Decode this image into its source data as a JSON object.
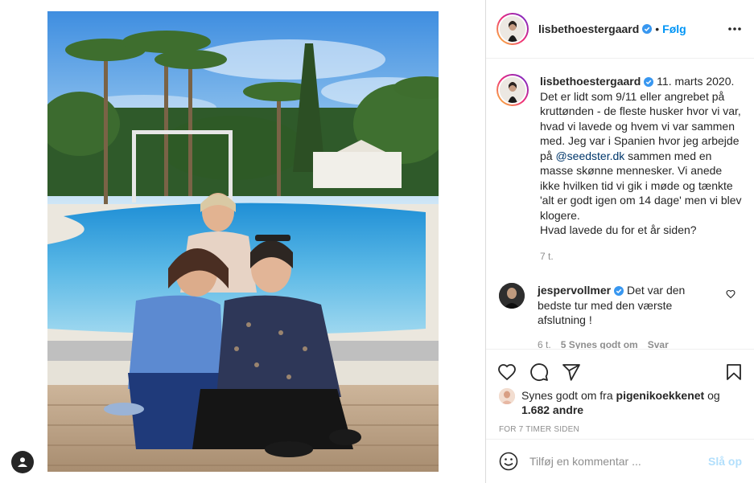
{
  "post": {
    "username": "lisbethoestergaard",
    "dot": "•",
    "follow_label": "Følg",
    "caption": {
      "username": "lisbethoestergaard",
      "date": "11. marts 2020.",
      "text_part1": "Det er lidt som 9/11 eller angrebet på kruttønden - de fleste husker hvor vi var, hvad vi lavede og hvem vi var sammen med. Jeg var i Spanien hvor jeg arbejde på ",
      "mention": "@seedster.dk",
      "text_part2": " sammen med en masse skønne mennesker. Vi anede ikke hvilken tid vi gik i møde og tænkte 'alt er godt igen om 14 dage' men vi blev klogere.\nHvad lavede du for et år siden?",
      "time": "7 t."
    },
    "comment": {
      "username": "jespervollmer",
      "text": "Det var den bedste tur med den værste afslutning !",
      "time": "6 t.",
      "likes": "5 Synes godt om",
      "reply": "Svar"
    },
    "likes": {
      "prefix": "Synes godt om fra",
      "by": "pigenikoekkenet",
      "and": "og",
      "others": "1.682 andre"
    },
    "timestamp": "FOR 7 TIMER SIDEN",
    "add_comment_placeholder": "Tilføj en kommentar ...",
    "post_label": "Slå op"
  },
  "icons": {
    "verified": "verified-badge-icon",
    "more": "more-options-icon",
    "like": "heart-icon",
    "comment": "comment-icon",
    "share": "paper-plane-icon",
    "save": "bookmark-icon",
    "emoji": "smiley-icon",
    "profile": "user-icon"
  },
  "colors": {
    "link": "#0095f6",
    "post_disabled": "#b2dffc",
    "verified": "#3897f0",
    "meta": "#8e8e8e"
  }
}
